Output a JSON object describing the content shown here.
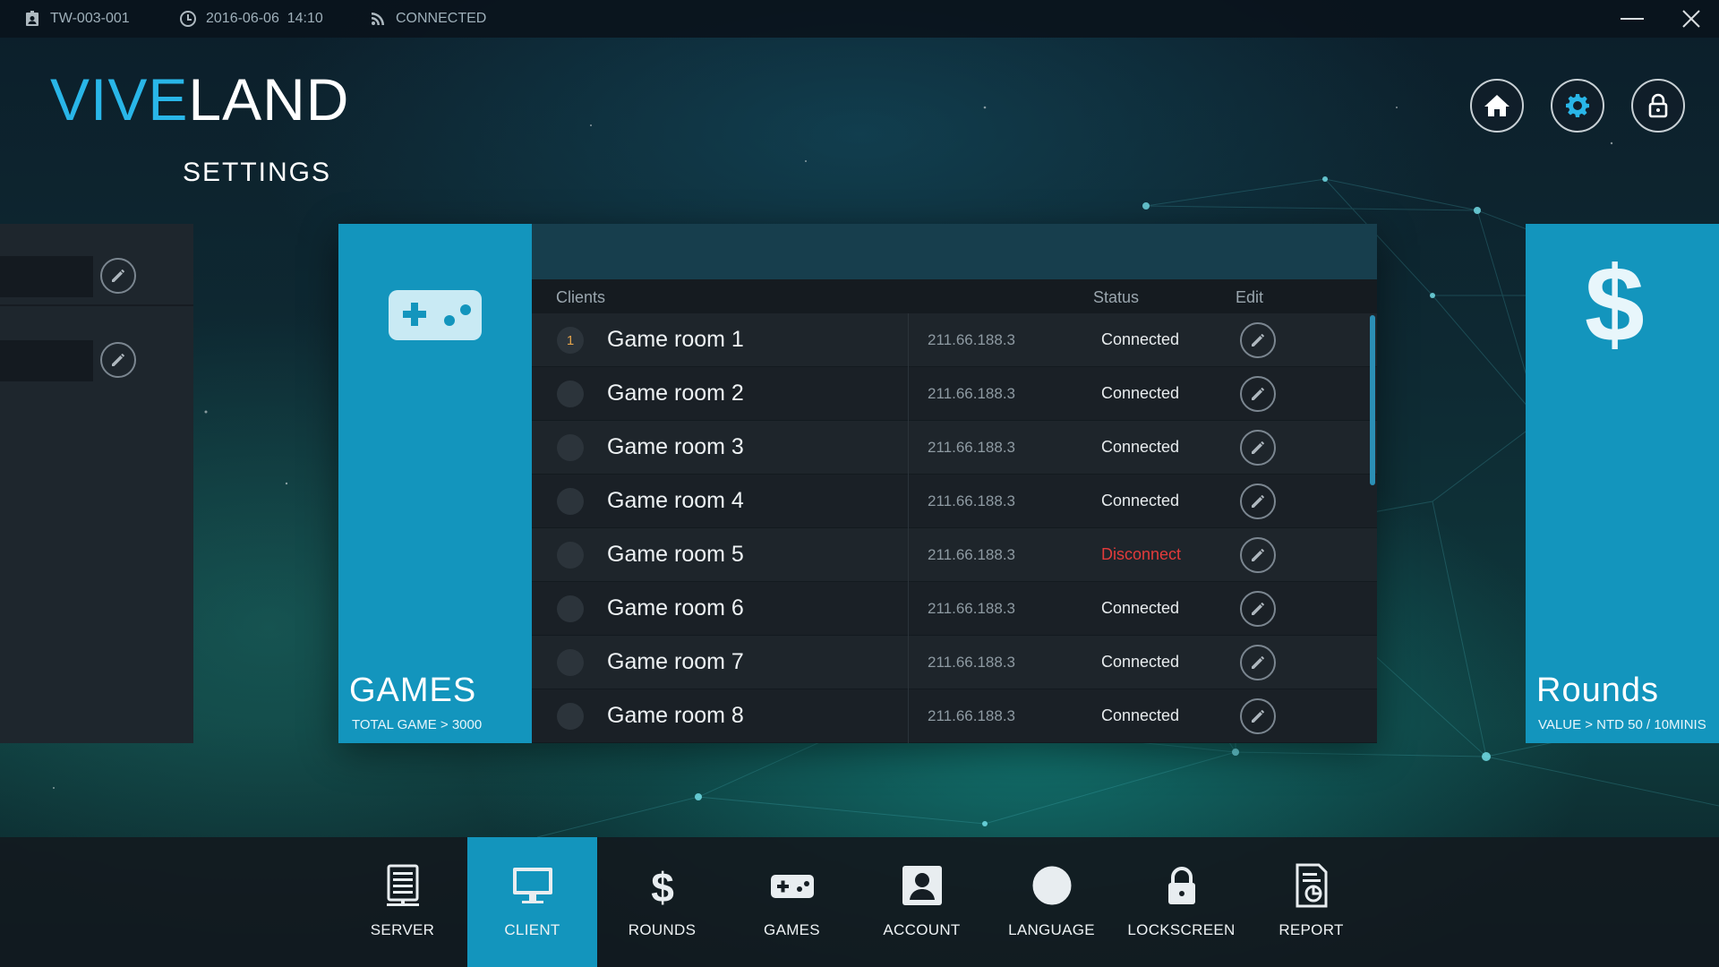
{
  "topbar": {
    "device_id": "TW-003-001",
    "datetime": "2016-06-06  14:10",
    "connection": "CONNECTED",
    "icons": [
      "badge-icon",
      "clock-icon",
      "rss-icon"
    ]
  },
  "window": {
    "minimize_icon": "minimize-icon",
    "close_icon": "close-icon"
  },
  "logo": {
    "part1": "VIVE",
    "part2": "LAND"
  },
  "page_subtitle": "SETTINGS",
  "header_buttons": [
    "home-icon",
    "gear-icon",
    "lock-icon"
  ],
  "colors": {
    "accent": "#1395bd",
    "brand_blue": "#29b6e8",
    "error": "#e23b3b",
    "number": "#e2a24a"
  },
  "games_panel": {
    "title": "GAMES",
    "subtitle": "TOTAL GAME > 3000",
    "icon": "gamepad-icon"
  },
  "client_list": {
    "columns": {
      "clients": "Clients",
      "status": "Status",
      "edit": "Edit"
    },
    "rows": [
      {
        "number": "1",
        "name": "Game room 1",
        "ip": "211.66.188.3",
        "status": "Connected",
        "ok": true
      },
      {
        "number": "",
        "name": "Game room 2",
        "ip": "211.66.188.3",
        "status": "Connected",
        "ok": true
      },
      {
        "number": "",
        "name": "Game room 3",
        "ip": "211.66.188.3",
        "status": "Connected",
        "ok": true
      },
      {
        "number": "",
        "name": "Game room 4",
        "ip": "211.66.188.3",
        "status": "Connected",
        "ok": true
      },
      {
        "number": "",
        "name": "Game room 5",
        "ip": "211.66.188.3",
        "status": "Disconnect",
        "ok": false
      },
      {
        "number": "",
        "name": "Game room 6",
        "ip": "211.66.188.3",
        "status": "Connected",
        "ok": true
      },
      {
        "number": "",
        "name": "Game room 7",
        "ip": "211.66.188.3",
        "status": "Connected",
        "ok": true
      },
      {
        "number": "",
        "name": "Game room 8",
        "ip": "211.66.188.3",
        "status": "Connected",
        "ok": true
      }
    ]
  },
  "rounds_panel": {
    "title": "Rounds",
    "subtitle": "VALUE > NTD 50 / 10MINIS",
    "icon": "dollar-icon",
    "glyph": "$"
  },
  "bottom_nav": [
    {
      "label": "SERVER",
      "icon": "server-icon",
      "active": false
    },
    {
      "label": "CLIENT",
      "icon": "monitor-icon",
      "active": true
    },
    {
      "label": "ROUNDS",
      "icon": "dollar-icon",
      "active": false
    },
    {
      "label": "GAMES",
      "icon": "gamepad-icon",
      "active": false
    },
    {
      "label": "ACCOUNT",
      "icon": "account-icon",
      "active": false
    },
    {
      "label": "LANGUAGE",
      "icon": "globe-icon",
      "active": false
    },
    {
      "label": "LOCKSCREEN",
      "icon": "lock-icon",
      "active": false
    },
    {
      "label": "REPORT",
      "icon": "report-icon",
      "active": false
    }
  ]
}
